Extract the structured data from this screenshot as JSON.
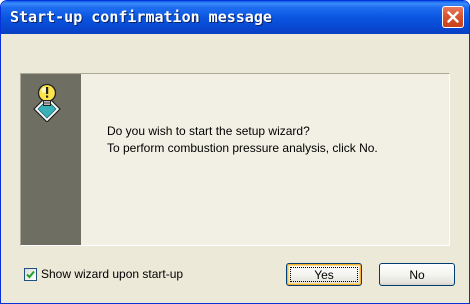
{
  "window": {
    "title": "Start-up confirmation message"
  },
  "message": {
    "line1": "Do you wish to start the setup wizard?",
    "line2": "To perform combustion pressure analysis, click No."
  },
  "options": {
    "show_wizard_label": "Show wizard upon start-up",
    "show_wizard_checked": true
  },
  "buttons": {
    "yes_label": "Yes",
    "no_label": "No"
  },
  "icons": {
    "close": "close-icon",
    "message": "lightbulb-tip-icon",
    "checkmark": "checkmark-icon"
  },
  "colors": {
    "titlebar": "#0a55e0",
    "close_button": "#d9552f",
    "icon_strip": "#6e6e62",
    "window_bg": "#ece9d8"
  }
}
